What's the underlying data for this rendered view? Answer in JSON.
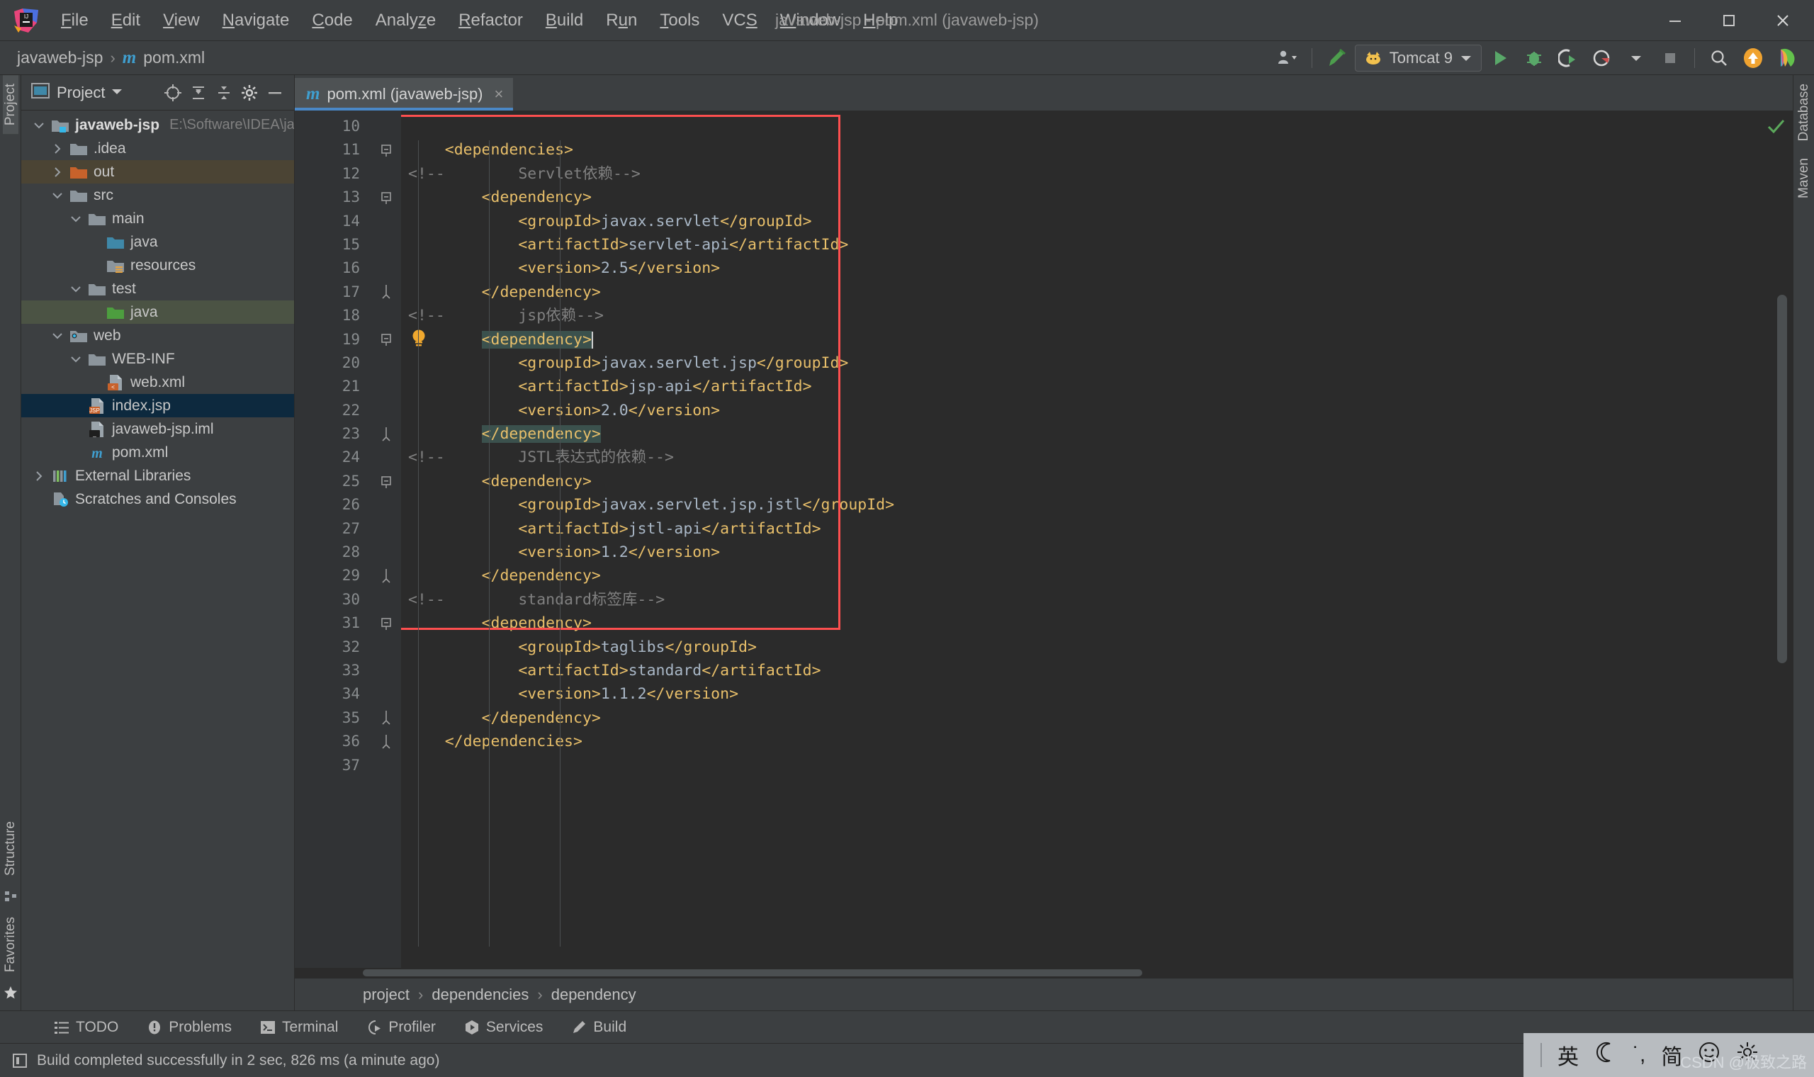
{
  "window": {
    "title": "javaweb-jsp - pom.xml (javaweb-jsp)",
    "minimize_icon": "minimize-icon",
    "maximize_icon": "maximize-icon",
    "close_icon": "close-icon"
  },
  "menu": [
    {
      "label": "File",
      "mnemonic": "F"
    },
    {
      "label": "Edit",
      "mnemonic": "E"
    },
    {
      "label": "View",
      "mnemonic": "V"
    },
    {
      "label": "Navigate",
      "mnemonic": "N"
    },
    {
      "label": "Code",
      "mnemonic": "C"
    },
    {
      "label": "Analyze",
      "mnemonic": "z"
    },
    {
      "label": "Refactor",
      "mnemonic": "R"
    },
    {
      "label": "Build",
      "mnemonic": "B"
    },
    {
      "label": "Run",
      "mnemonic": "u"
    },
    {
      "label": "Tools",
      "mnemonic": "T"
    },
    {
      "label": "VCS",
      "mnemonic": "S"
    },
    {
      "label": "Window",
      "mnemonic": "W"
    },
    {
      "label": "Help",
      "mnemonic": "H"
    }
  ],
  "toolbar": {
    "breadcrumb": [
      "javaweb-jsp",
      "pom.xml"
    ],
    "breadcrumb_sep": "›",
    "project_file_icon": "m",
    "run_config": "Tomcat 9",
    "icons": [
      "user-dropdown-icon",
      "build-hammer-icon",
      "run-icon",
      "debug-icon",
      "run-coverage-icon",
      "profile-icon",
      "stop-icon",
      "search-everywhere-icon",
      "update-project-icon",
      "ide-helper-icon"
    ]
  },
  "left_strip": {
    "tabs": [
      "Project",
      "Structure",
      "Favorites"
    ]
  },
  "right_strip": {
    "tabs": [
      "Database",
      "Maven"
    ]
  },
  "project_panel": {
    "title": "Project",
    "header_icons": [
      "locate-icon",
      "expand-all-icon",
      "collapse-all-icon",
      "settings-gear-icon",
      "hide-icon"
    ],
    "tree": [
      {
        "label": "javaweb-jsp",
        "path": "E:\\Software\\IDEA\\javaweb-jsp",
        "indent": 0,
        "arrow": "down",
        "icon": "module-folder-icon",
        "bold": true,
        "state": "none"
      },
      {
        "label": ".idea",
        "path": "",
        "indent": 1,
        "arrow": "right",
        "icon": "folder-icon",
        "bold": false,
        "state": "none"
      },
      {
        "label": "out",
        "path": "",
        "indent": 1,
        "arrow": "right",
        "icon": "folder-excluded-icon",
        "bold": false,
        "state": "sel-out"
      },
      {
        "label": "src",
        "path": "",
        "indent": 1,
        "arrow": "down",
        "icon": "folder-icon",
        "bold": false,
        "state": "none"
      },
      {
        "label": "main",
        "path": "",
        "indent": 2,
        "arrow": "down",
        "icon": "folder-icon",
        "bold": false,
        "state": "none"
      },
      {
        "label": "java",
        "path": "",
        "indent": 3,
        "arrow": "none",
        "icon": "folder-source-icon",
        "bold": false,
        "state": "none"
      },
      {
        "label": "resources",
        "path": "",
        "indent": 3,
        "arrow": "none",
        "icon": "folder-resources-icon",
        "bold": false,
        "state": "none"
      },
      {
        "label": "test",
        "path": "",
        "indent": 2,
        "arrow": "down",
        "icon": "folder-icon",
        "bold": false,
        "state": "none"
      },
      {
        "label": "java",
        "path": "",
        "indent": 3,
        "arrow": "none",
        "icon": "folder-test-source-icon",
        "bold": false,
        "state": "sel-green"
      },
      {
        "label": "web",
        "path": "",
        "indent": 1,
        "arrow": "down",
        "icon": "folder-web-icon",
        "bold": false,
        "state": "none"
      },
      {
        "label": "WEB-INF",
        "path": "",
        "indent": 2,
        "arrow": "down",
        "icon": "folder-icon",
        "bold": false,
        "state": "none"
      },
      {
        "label": "web.xml",
        "path": "",
        "indent": 3,
        "arrow": "none",
        "icon": "web-xml-file-icon",
        "bold": false,
        "state": "none"
      },
      {
        "label": "index.jsp",
        "path": "",
        "indent": 2,
        "arrow": "none",
        "icon": "jsp-file-icon",
        "bold": false,
        "state": "sel-blue"
      },
      {
        "label": "javaweb-jsp.iml",
        "path": "",
        "indent": 2,
        "arrow": "none",
        "icon": "iml-file-icon",
        "bold": false,
        "state": "none"
      },
      {
        "label": "pom.xml",
        "path": "",
        "indent": 2,
        "arrow": "none",
        "icon": "maven-pom-icon",
        "bold": false,
        "state": "none"
      },
      {
        "label": "External Libraries",
        "path": "",
        "indent": 0,
        "arrow": "right",
        "icon": "libraries-icon",
        "bold": false,
        "state": "none"
      },
      {
        "label": "Scratches and Consoles",
        "path": "",
        "indent": 0,
        "arrow": "none",
        "icon": "scratches-icon",
        "bold": false,
        "state": "none"
      }
    ]
  },
  "editor": {
    "tab": {
      "label": "pom.xml (javaweb-jsp)",
      "icon": "maven-pom-icon",
      "close": "×"
    },
    "first_line_number": 10,
    "lines": [
      {
        "n": 10,
        "fold": "none",
        "bulb": false,
        "hl": false,
        "segments": []
      },
      {
        "n": 11,
        "fold": "minus",
        "bulb": false,
        "hl": false,
        "segments": [
          {
            "t": "    ",
            "c": "txt"
          },
          {
            "t": "<dependencies>",
            "c": "tag"
          }
        ]
      },
      {
        "n": 12,
        "fold": "none",
        "bulb": false,
        "hl": false,
        "segments": [
          {
            "t": "<!--        Servlet依赖-->",
            "c": "cmt"
          }
        ],
        "comment_full": true
      },
      {
        "n": 13,
        "fold": "minus",
        "bulb": false,
        "hl": false,
        "segments": [
          {
            "t": "        ",
            "c": "txt"
          },
          {
            "t": "<dependency>",
            "c": "tag"
          }
        ]
      },
      {
        "n": 14,
        "fold": "none",
        "bulb": false,
        "hl": false,
        "segments": [
          {
            "t": "            ",
            "c": "txt"
          },
          {
            "t": "<groupId>",
            "c": "tag"
          },
          {
            "t": "javax.servlet",
            "c": "txt"
          },
          {
            "t": "</groupId>",
            "c": "tag"
          }
        ]
      },
      {
        "n": 15,
        "fold": "none",
        "bulb": false,
        "hl": false,
        "segments": [
          {
            "t": "            ",
            "c": "txt"
          },
          {
            "t": "<artifactId>",
            "c": "tag"
          },
          {
            "t": "servlet-api",
            "c": "txt"
          },
          {
            "t": "</artifactId>",
            "c": "tag"
          }
        ]
      },
      {
        "n": 16,
        "fold": "none",
        "bulb": false,
        "hl": false,
        "segments": [
          {
            "t": "            ",
            "c": "txt"
          },
          {
            "t": "<version>",
            "c": "tag"
          },
          {
            "t": "2.5",
            "c": "txt"
          },
          {
            "t": "</version>",
            "c": "tag"
          }
        ]
      },
      {
        "n": 17,
        "fold": "end",
        "bulb": false,
        "hl": false,
        "segments": [
          {
            "t": "        ",
            "c": "txt"
          },
          {
            "t": "</dependency>",
            "c": "tag"
          }
        ]
      },
      {
        "n": 18,
        "fold": "none",
        "bulb": false,
        "hl": false,
        "segments": [
          {
            "t": "<!--        jsp依赖-->",
            "c": "cmt"
          }
        ],
        "comment_full": true
      },
      {
        "n": 19,
        "fold": "minus",
        "bulb": true,
        "hl": true,
        "segments": [
          {
            "t": "        ",
            "c": "txt"
          },
          {
            "t": "<dependency>",
            "c": "tag hl"
          }
        ],
        "caret": true
      },
      {
        "n": 20,
        "fold": "none",
        "bulb": false,
        "hl": false,
        "segments": [
          {
            "t": "            ",
            "c": "txt"
          },
          {
            "t": "<groupId>",
            "c": "tag"
          },
          {
            "t": "javax.servlet.jsp",
            "c": "txt"
          },
          {
            "t": "</groupId>",
            "c": "tag"
          }
        ]
      },
      {
        "n": 21,
        "fold": "none",
        "bulb": false,
        "hl": false,
        "segments": [
          {
            "t": "            ",
            "c": "txt"
          },
          {
            "t": "<artifactId>",
            "c": "tag"
          },
          {
            "t": "jsp-api",
            "c": "txt"
          },
          {
            "t": "</artifactId>",
            "c": "tag"
          }
        ]
      },
      {
        "n": 22,
        "fold": "none",
        "bulb": false,
        "hl": false,
        "segments": [
          {
            "t": "            ",
            "c": "txt"
          },
          {
            "t": "<version>",
            "c": "tag"
          },
          {
            "t": "2.0",
            "c": "txt"
          },
          {
            "t": "</version>",
            "c": "tag"
          }
        ]
      },
      {
        "n": 23,
        "fold": "end",
        "bulb": false,
        "hl": false,
        "segments": [
          {
            "t": "        ",
            "c": "txt"
          },
          {
            "t": "</dependency>",
            "c": "tag hl"
          }
        ]
      },
      {
        "n": 24,
        "fold": "none",
        "bulb": false,
        "hl": false,
        "segments": [
          {
            "t": "<!--        JSTL表达式的依赖-->",
            "c": "cmt"
          }
        ],
        "comment_full": true
      },
      {
        "n": 25,
        "fold": "minus",
        "bulb": false,
        "hl": false,
        "segments": [
          {
            "t": "        ",
            "c": "txt"
          },
          {
            "t": "<dependency>",
            "c": "tag"
          }
        ]
      },
      {
        "n": 26,
        "fold": "none",
        "bulb": false,
        "hl": false,
        "segments": [
          {
            "t": "            ",
            "c": "txt"
          },
          {
            "t": "<groupId>",
            "c": "tag"
          },
          {
            "t": "javax.servlet.jsp.jstl",
            "c": "txt"
          },
          {
            "t": "</groupId>",
            "c": "tag"
          }
        ]
      },
      {
        "n": 27,
        "fold": "none",
        "bulb": false,
        "hl": false,
        "segments": [
          {
            "t": "            ",
            "c": "txt"
          },
          {
            "t": "<artifactId>",
            "c": "tag"
          },
          {
            "t": "jstl-api",
            "c": "txt"
          },
          {
            "t": "</artifactId>",
            "c": "tag"
          }
        ]
      },
      {
        "n": 28,
        "fold": "none",
        "bulb": false,
        "hl": false,
        "segments": [
          {
            "t": "            ",
            "c": "txt"
          },
          {
            "t": "<version>",
            "c": "tag"
          },
          {
            "t": "1.2",
            "c": "txt"
          },
          {
            "t": "</version>",
            "c": "tag"
          }
        ]
      },
      {
        "n": 29,
        "fold": "end",
        "bulb": false,
        "hl": false,
        "segments": [
          {
            "t": "        ",
            "c": "txt"
          },
          {
            "t": "</dependency>",
            "c": "tag"
          }
        ]
      },
      {
        "n": 30,
        "fold": "none",
        "bulb": false,
        "hl": false,
        "segments": [
          {
            "t": "<!--        standard标签库-->",
            "c": "cmt"
          }
        ],
        "comment_full": true
      },
      {
        "n": 31,
        "fold": "minus",
        "bulb": false,
        "hl": false,
        "segments": [
          {
            "t": "        ",
            "c": "txt"
          },
          {
            "t": "<dependency>",
            "c": "tag"
          }
        ]
      },
      {
        "n": 32,
        "fold": "none",
        "bulb": false,
        "hl": false,
        "segments": [
          {
            "t": "            ",
            "c": "txt"
          },
          {
            "t": "<groupId>",
            "c": "tag"
          },
          {
            "t": "taglibs",
            "c": "txt"
          },
          {
            "t": "</groupId>",
            "c": "tag"
          }
        ]
      },
      {
        "n": 33,
        "fold": "none",
        "bulb": false,
        "hl": false,
        "segments": [
          {
            "t": "            ",
            "c": "txt"
          },
          {
            "t": "<artifactId>",
            "c": "tag"
          },
          {
            "t": "standard",
            "c": "txt"
          },
          {
            "t": "</artifactId>",
            "c": "tag"
          }
        ]
      },
      {
        "n": 34,
        "fold": "none",
        "bulb": false,
        "hl": false,
        "segments": [
          {
            "t": "            ",
            "c": "txt"
          },
          {
            "t": "<version>",
            "c": "tag"
          },
          {
            "t": "1.1.2",
            "c": "txt"
          },
          {
            "t": "</version>",
            "c": "tag"
          }
        ]
      },
      {
        "n": 35,
        "fold": "end",
        "bulb": false,
        "hl": false,
        "segments": [
          {
            "t": "        ",
            "c": "txt"
          },
          {
            "t": "</dependency>",
            "c": "tag"
          }
        ]
      },
      {
        "n": 36,
        "fold": "end",
        "bulb": false,
        "hl": false,
        "segments": [
          {
            "t": "    ",
            "c": "txt"
          },
          {
            "t": "</dependencies>",
            "c": "tag"
          }
        ]
      },
      {
        "n": 37,
        "fold": "none",
        "bulb": false,
        "hl": false,
        "segments": []
      }
    ],
    "inspection_status": "no-errors-check-icon",
    "breadcrumb": [
      "project",
      "dependencies",
      "dependency"
    ],
    "breadcrumb_sep": "›"
  },
  "bottom": {
    "tool_windows": [
      {
        "label": "TODO",
        "icon": "todo-icon"
      },
      {
        "label": "Problems",
        "icon": "problems-icon"
      },
      {
        "label": "Terminal",
        "icon": "terminal-icon"
      },
      {
        "label": "Profiler",
        "icon": "profiler-icon"
      },
      {
        "label": "Services",
        "icon": "services-icon"
      },
      {
        "label": "Build",
        "icon": "build-icon"
      }
    ],
    "status_text": "Build completed successfully in 2 sec, 826 ms (a minute ago)",
    "status_icon": "event-log-icon"
  },
  "ime": {
    "mode": "英",
    "moon": "☾",
    "punct": "˙,",
    "script": "简",
    "smiley": "smiley-icon",
    "gear": "gear-icon",
    "watermark": "CSDN @极致之路"
  },
  "colors": {
    "accent": "#4a88c7",
    "tag": "#e8bf6a",
    "comment": "#808080",
    "text": "#a9b7c6",
    "editor_bg": "#2b2b2b",
    "panel_bg": "#3c3f41",
    "redbox": "#fd4f4f",
    "selection_blue": "#0d293e",
    "highlight_green": "#3b514d"
  }
}
